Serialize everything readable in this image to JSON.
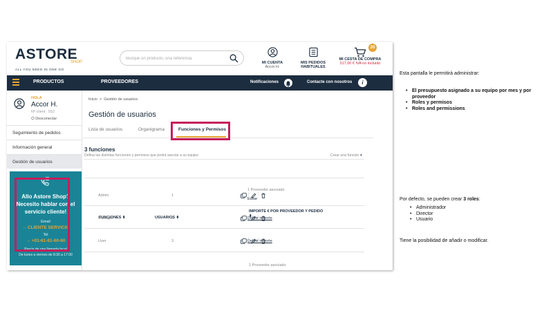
{
  "header": {
    "logo_main": "ASTORE",
    "logo_shop": "SHOP",
    "logo_tagline": "ALL YOU NEED IN ONE GO",
    "search_placeholder": "Busque un producto, una referencia",
    "account_label": "MI CUENTA",
    "account_user": "Accor H.",
    "orders_label": "MIS PEDIDOS HABITUALES",
    "cart_label": "MI CESTA DE COMPRA",
    "cart_count": "20",
    "cart_price": "317,00 € IVA no incluido"
  },
  "nav": {
    "productos": "PRODUCTOS",
    "proveedores": "PROVEEDORES",
    "notificaciones": "Notificaciones",
    "contacto": "Contacte con nosotros"
  },
  "sidebar": {
    "hola": "HOLA",
    "user_name": "Accor H.",
    "client_no": "Nº client : 552",
    "logout": "Desconectar",
    "items": [
      {
        "label": "Seguimiento de pedidos"
      },
      {
        "label": "Información general"
      },
      {
        "label": "Gestión de usuarios"
      }
    ],
    "help": {
      "title": "Allo Astore Shop? Necesito hablar con el servicio cliente!",
      "email_label": "Email",
      "email_cta": "CLIENTE SERVICIO",
      "tel_label": "Tel",
      "tel_number": "+01-61-61-60-60",
      "price_note": "Precio de una llamada local",
      "hours": "De lunes a viernes de 8:30 a 17:00"
    }
  },
  "main": {
    "breadcrumb_home": "Inicio",
    "breadcrumb_sep": ">",
    "breadcrumb_current": "Gestión de usuarios",
    "title": "Gestión de usuarios",
    "tabs": [
      {
        "label": "Lista de usuarios"
      },
      {
        "label": "Organigrama"
      },
      {
        "label": "Funciones y Permisos"
      }
    ],
    "functions_count": "3 funciones",
    "functions_desc": "Defina las distintas funciones y permisos que podrá asociar a su equipo",
    "create_function": "Crear una función",
    "columns": {
      "funciones": "FUNCIONES",
      "usuarios": "USUARIOS",
      "importe": "IMPORTE € POR PROVEEDOR Y PEDIDO"
    },
    "rows": [
      {
        "name": "Admin",
        "users": "1",
        "importe_text": "1 Proveedor asociado",
        "action": "Editar"
      },
      {
        "name": "Manager",
        "users": "3",
        "importe_text": "",
        "action": "Definir importe"
      },
      {
        "name": "User",
        "users": "3",
        "importe_text": "",
        "action": "Definir importe"
      }
    ],
    "partial_row_text": "1 Proveedor asociado"
  },
  "notes": {
    "intro": "Esta pantalla le permitirá administrar:",
    "bullets1": [
      "El presupuesto asignado a su equipo por mes y por proveedor",
      "Roles y permisos",
      "Roles and permissions"
    ],
    "roles_intro_pre": "Por defecto, se pueden crear ",
    "roles_intro_bold": "3 roles",
    "roles_intro_post": ":",
    "roles": [
      "Administrador",
      "Director",
      "Usuario"
    ],
    "footer": "Tiene la posibilidad de añadir o modificar."
  },
  "colors": {
    "navy": "#1c2d3f",
    "orange": "#e8a431",
    "teal": "#1a8496",
    "highlight": "#c41e5c",
    "price_red": "#d0233a"
  }
}
